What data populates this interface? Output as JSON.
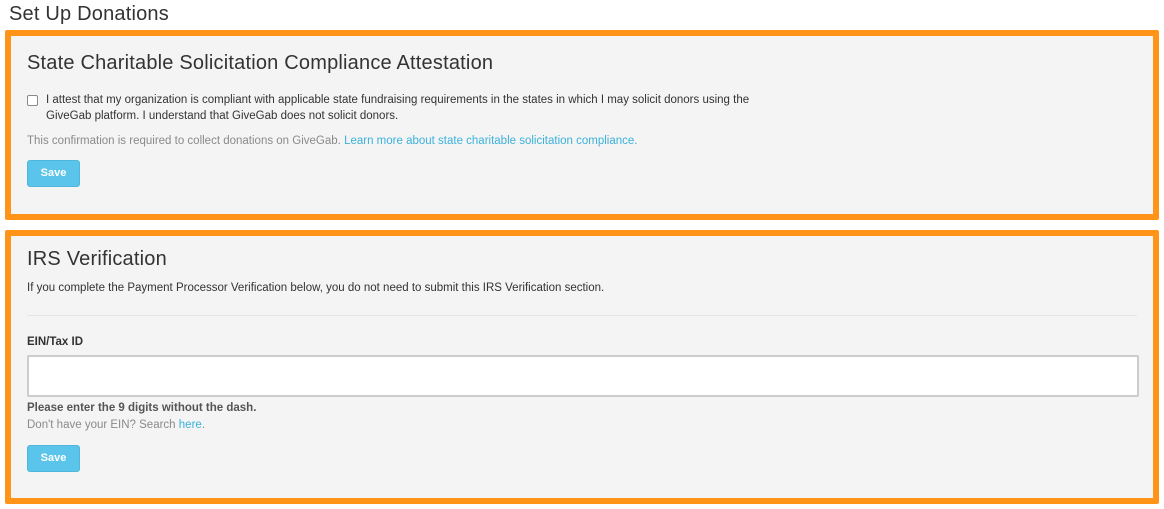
{
  "page": {
    "title": "Set Up Donations"
  },
  "attestation": {
    "heading": "State Charitable Solicitation Compliance Attestation",
    "checkbox_checked": false,
    "checkbox_text": "I attest that my organization is compliant with applicable state fundraising requirements in the states in which I may solicit donors using the GiveGab platform. I understand that GiveGab does not solicit donors.",
    "confirmation_text": "This confirmation is required to collect donations on GiveGab. ",
    "learn_more_link": "Learn more about state charitable solicitation compliance.",
    "save_label": "Save"
  },
  "irs": {
    "heading": "IRS Verification",
    "intro": "If you complete the Payment Processor Verification below, you do not need to submit this IRS Verification section.",
    "ein_label": "EIN/Tax ID",
    "ein_value": "",
    "ein_hint": "Please enter the 9 digits without the dash.",
    "ein_help_text": "Don't have your EIN? Search ",
    "ein_help_link": "here",
    "ein_help_suffix": ".",
    "save_label": "Save"
  },
  "colors": {
    "highlight_border": "#ff9418",
    "panel_background": "#f4f4f4",
    "button": "#5bc4ea",
    "link": "#3bb1dc"
  }
}
